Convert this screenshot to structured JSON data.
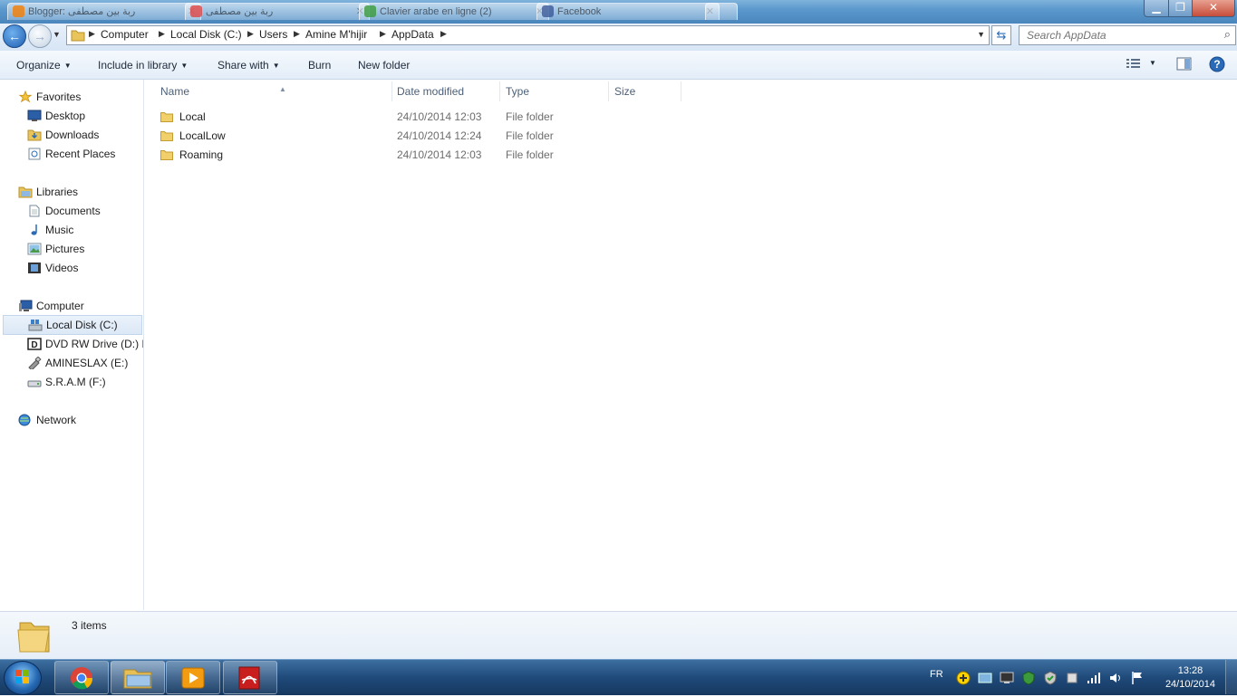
{
  "window": {
    "background_tabs": [
      "Blogger: ربة بين مصطفى",
      "ربة بين مصطفى",
      "Clavier arabe en ligne (2)",
      "Facebook"
    ]
  },
  "address": {
    "breadcrumbs": [
      "Computer",
      "Local Disk (C:)",
      "Users",
      "Amine M'hijir",
      "AppData"
    ]
  },
  "search": {
    "placeholder": "Search AppData"
  },
  "toolbar": {
    "organize": "Organize",
    "include_in_library": "Include in library",
    "share_with": "Share with",
    "burn": "Burn",
    "new_folder": "New folder"
  },
  "sidebar": {
    "favorites": {
      "label": "Favorites",
      "items": [
        "Desktop",
        "Downloads",
        "Recent Places"
      ]
    },
    "libraries": {
      "label": "Libraries",
      "items": [
        "Documents",
        "Music",
        "Pictures",
        "Videos"
      ]
    },
    "computer": {
      "label": "Computer",
      "items": [
        "Local Disk (C:)",
        "DVD RW Drive (D:) D",
        "AMINESLAX (E:)",
        "S.R.A.M (F:)"
      ]
    },
    "network": {
      "label": "Network"
    }
  },
  "columns": {
    "name": "Name",
    "date_modified": "Date modified",
    "type": "Type",
    "size": "Size"
  },
  "files": [
    {
      "name": "Local",
      "date": "24/10/2014 12:03",
      "type": "File folder"
    },
    {
      "name": "LocalLow",
      "date": "24/10/2014 12:24",
      "type": "File folder"
    },
    {
      "name": "Roaming",
      "date": "24/10/2014 12:03",
      "type": "File folder"
    }
  ],
  "status": {
    "item_count": "3 items"
  },
  "taskbar": {
    "language": "FR",
    "time": "13:28",
    "date": "24/10/2014"
  },
  "colors": {
    "accent": "#2a6bb8",
    "selection": "#dce8f6",
    "taskbar": "#1f4a7a"
  }
}
